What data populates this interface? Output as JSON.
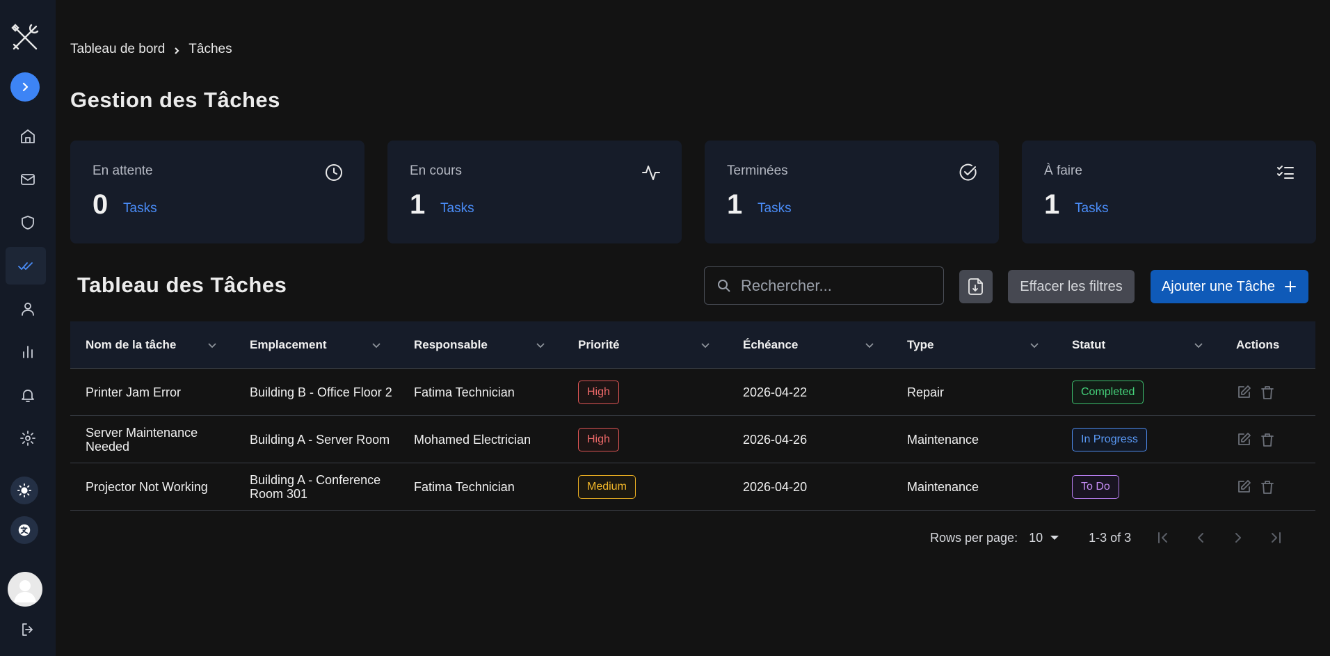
{
  "breadcrumb": {
    "home": "Tableau de bord",
    "current": "Tâches"
  },
  "page": {
    "title": "Gestion des Tâches"
  },
  "stats": [
    {
      "label": "En attente",
      "count": "0",
      "unit": "Tasks",
      "icon": "clock-icon"
    },
    {
      "label": "En cours",
      "count": "1",
      "unit": "Tasks",
      "icon": "activity-icon"
    },
    {
      "label": "Terminées",
      "count": "1",
      "unit": "Tasks",
      "icon": "check-circle-icon"
    },
    {
      "label": "À faire",
      "count": "1",
      "unit": "Tasks",
      "icon": "list-checks-icon"
    }
  ],
  "table": {
    "title": "Tableau des Tâches",
    "search_placeholder": "Rechercher...",
    "clear_label": "Effacer les filtres",
    "add_label": "Ajouter une Tâche",
    "columns": [
      "Nom de la tâche",
      "Emplacement",
      "Responsable",
      "Priorité",
      "Échéance",
      "Type",
      "Statut",
      "Actions"
    ],
    "rows": [
      {
        "name": "Printer Jam Error",
        "location": "Building B - Office Floor 2",
        "assignee": "Fatima Technician",
        "priority": "High",
        "due": "2026-04-22",
        "type": "Repair",
        "status": "Completed"
      },
      {
        "name": "Server Maintenance Needed",
        "location": "Building A - Server Room",
        "assignee": "Mohamed Electrician",
        "priority": "High",
        "due": "2026-04-26",
        "type": "Maintenance",
        "status": "In Progress"
      },
      {
        "name": "Projector Not Working",
        "location": "Building A - Conference Room 301",
        "assignee": "Fatima Technician",
        "priority": "Medium",
        "due": "2026-04-20",
        "type": "Maintenance",
        "status": "To Do"
      }
    ]
  },
  "pagination": {
    "rows_per_page_label": "Rows per page:",
    "rows_per_page": "10",
    "range": "1-3 of 3"
  },
  "colors": {
    "accent": "#3d84f5",
    "primary_button": "#0f5ab8",
    "high": "#e05656",
    "medium": "#e8ad22",
    "completed": "#3cbf6e",
    "in_progress": "#4f8df0",
    "todo": "#b77ef0"
  }
}
